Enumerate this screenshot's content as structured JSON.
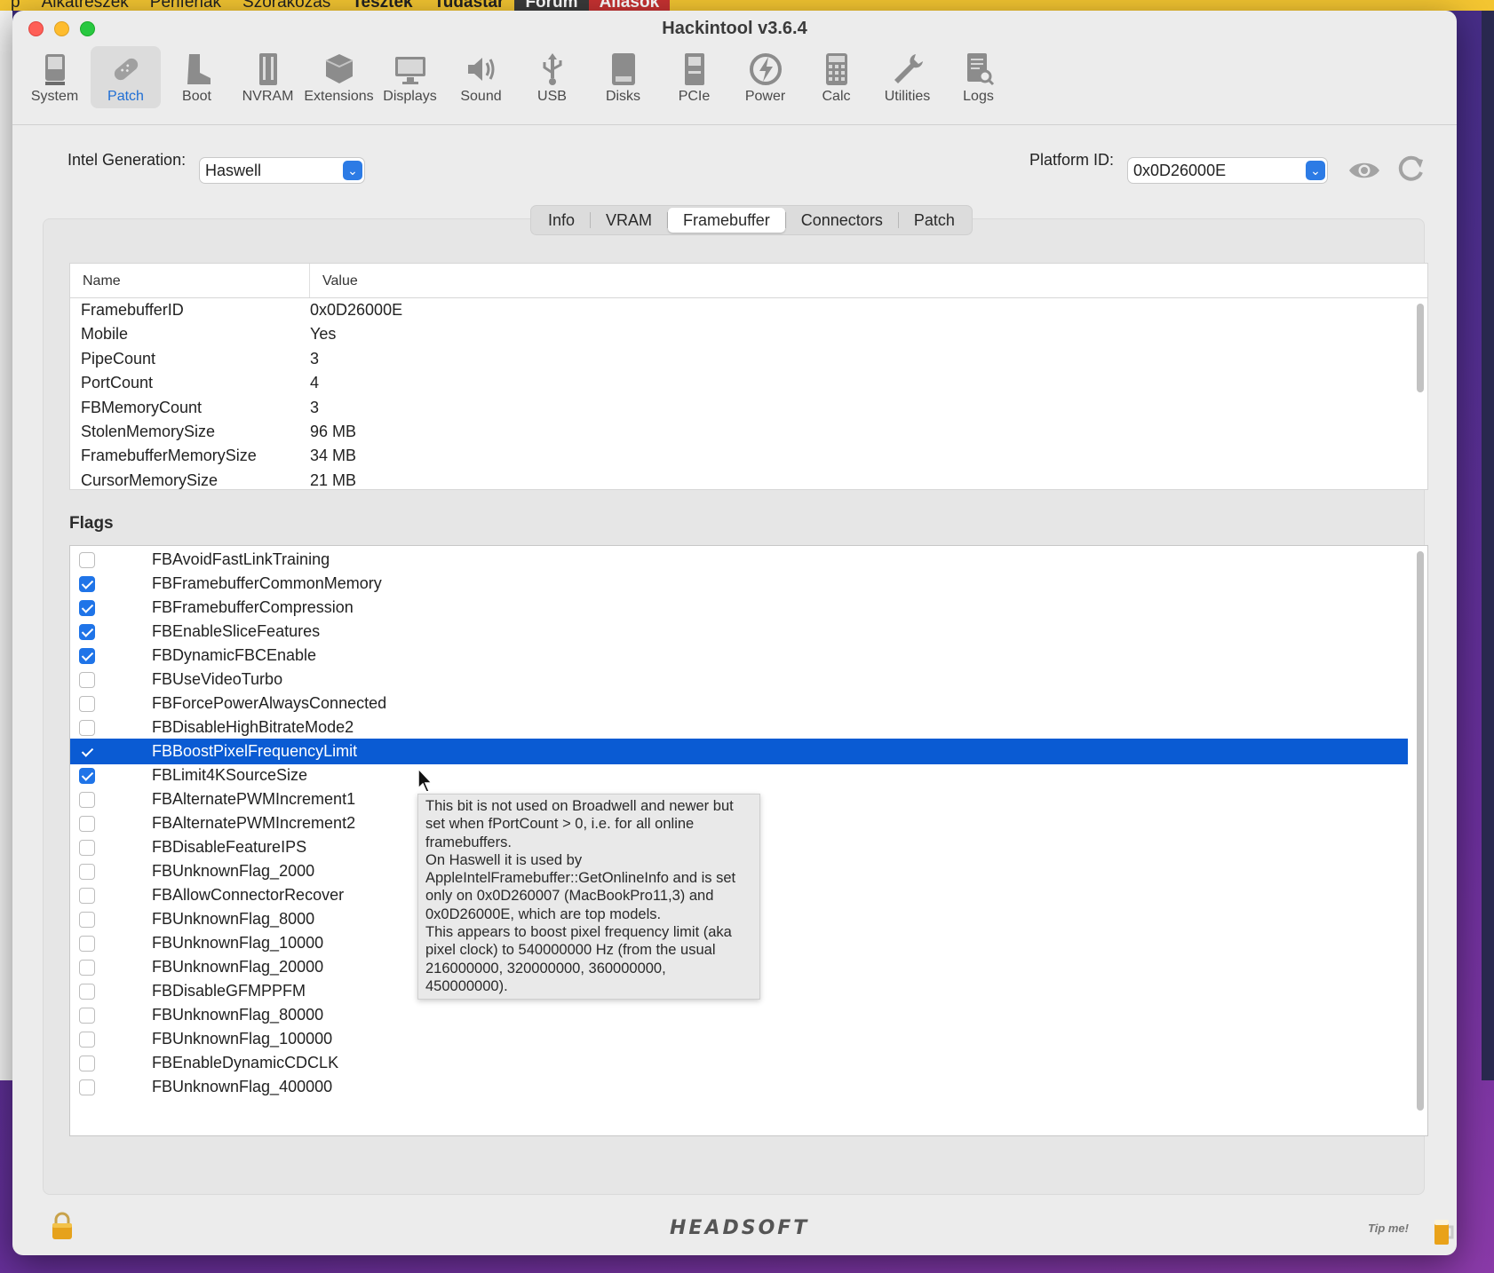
{
  "background": {
    "menu": [
      {
        "label": "p",
        "style": ""
      },
      {
        "label": "Alkatrészek",
        "style": ""
      },
      {
        "label": "Perifériák",
        "style": ""
      },
      {
        "label": "Szórakozás",
        "style": ""
      },
      {
        "label": "Tesztek",
        "style": "bold"
      },
      {
        "label": "Tudástár",
        "style": "bold"
      },
      {
        "label": "Fórum",
        "style": "dark"
      },
      {
        "label": "Állások",
        "style": "red"
      }
    ]
  },
  "window": {
    "title": "Hackintool v3.6.4"
  },
  "toolbar": {
    "items": [
      {
        "label": "System",
        "icon": "system-icon",
        "active": false
      },
      {
        "label": "Patch",
        "icon": "patch-icon",
        "active": true
      },
      {
        "label": "Boot",
        "icon": "boot-icon",
        "active": false
      },
      {
        "label": "NVRAM",
        "icon": "nvram-icon",
        "active": false
      },
      {
        "label": "Extensions",
        "icon": "extensions-icon",
        "active": false
      },
      {
        "label": "Displays",
        "icon": "displays-icon",
        "active": false
      },
      {
        "label": "Sound",
        "icon": "sound-icon",
        "active": false
      },
      {
        "label": "USB",
        "icon": "usb-icon",
        "active": false
      },
      {
        "label": "Disks",
        "icon": "disks-icon",
        "active": false
      },
      {
        "label": "PCIe",
        "icon": "pcie-icon",
        "active": false
      },
      {
        "label": "Power",
        "icon": "power-icon",
        "active": false
      },
      {
        "label": "Calc",
        "icon": "calc-icon",
        "active": false
      },
      {
        "label": "Utilities",
        "icon": "utilities-icon",
        "active": false
      },
      {
        "label": "Logs",
        "icon": "logs-icon",
        "active": false
      }
    ]
  },
  "controls": {
    "generation_label": "Intel Generation:",
    "generation_value": "Haswell",
    "platform_label": "Platform ID:",
    "platform_value": "0x0D26000E"
  },
  "tabs": [
    {
      "label": "Info",
      "active": false
    },
    {
      "label": "VRAM",
      "active": false
    },
    {
      "label": "Framebuffer",
      "active": true
    },
    {
      "label": "Connectors",
      "active": false
    },
    {
      "label": "Patch",
      "active": false
    }
  ],
  "info_table": {
    "columns": [
      "Name",
      "Value"
    ],
    "rows": [
      {
        "name": "FramebufferID",
        "value": "0x0D26000E"
      },
      {
        "name": "Mobile",
        "value": "Yes"
      },
      {
        "name": "PipeCount",
        "value": "3"
      },
      {
        "name": "PortCount",
        "value": "4"
      },
      {
        "name": "FBMemoryCount",
        "value": "3"
      },
      {
        "name": "StolenMemorySize",
        "value": "96 MB"
      },
      {
        "name": "FramebufferMemorySize",
        "value": "34 MB"
      },
      {
        "name": "CursorMemorySize",
        "value": "21 MB"
      }
    ]
  },
  "flags": {
    "title": "Flags",
    "items": [
      {
        "name": "FBAvoidFastLinkTraining",
        "checked": false
      },
      {
        "name": "FBFramebufferCommonMemory",
        "checked": true
      },
      {
        "name": "FBFramebufferCompression",
        "checked": true
      },
      {
        "name": "FBEnableSliceFeatures",
        "checked": true
      },
      {
        "name": "FBDynamicFBCEnable",
        "checked": true
      },
      {
        "name": "FBUseVideoTurbo",
        "checked": false
      },
      {
        "name": "FBForcePowerAlwaysConnected",
        "checked": false
      },
      {
        "name": "FBDisableHighBitrateMode2",
        "checked": false
      },
      {
        "name": "FBBoostPixelFrequencyLimit",
        "checked": true,
        "selected": true
      },
      {
        "name": "FBLimit4KSourceSize",
        "checked": true
      },
      {
        "name": "FBAlternatePWMIncrement1",
        "checked": false
      },
      {
        "name": "FBAlternatePWMIncrement2",
        "checked": false
      },
      {
        "name": "FBDisableFeatureIPS",
        "checked": false
      },
      {
        "name": "FBUnknownFlag_2000",
        "checked": false
      },
      {
        "name": "FBAllowConnectorRecover",
        "checked": false
      },
      {
        "name": "FBUnknownFlag_8000",
        "checked": false
      },
      {
        "name": "FBUnknownFlag_10000",
        "checked": false
      },
      {
        "name": "FBUnknownFlag_20000",
        "checked": false
      },
      {
        "name": "FBDisableGFMPPFM",
        "checked": false
      },
      {
        "name": "FBUnknownFlag_80000",
        "checked": false
      },
      {
        "name": "FBUnknownFlag_100000",
        "checked": false
      },
      {
        "name": "FBEnableDynamicCDCLK",
        "checked": false
      },
      {
        "name": "FBUnknownFlag_400000",
        "checked": false
      }
    ]
  },
  "tooltip": {
    "text": "This bit is not used on Broadwell and newer but\nset when fPortCount > 0, i.e. for all online\nframebuffers.\nOn Haswell it is used by\nAppleIntelFramebuffer::GetOnlineInfo and is set\nonly on 0x0D260007 (MacBookPro11,3) and\n0x0D26000E, which are top models.\nThis appears to boost pixel frequency limit (aka\npixel clock) to 540000000 Hz (from the usual\n216000000, 320000000, 360000000,\n450000000)."
  },
  "footer": {
    "logo": "HEADSOFT",
    "tip": "Tip me!"
  },
  "colors": {
    "accent": "#1f74e8",
    "selection": "#0a5bd3"
  }
}
